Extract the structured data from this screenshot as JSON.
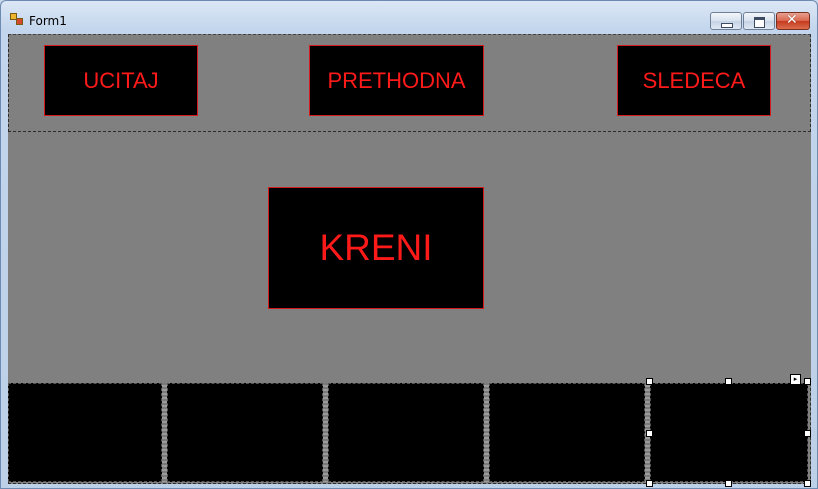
{
  "window": {
    "title": "Form1"
  },
  "caption_buttons": {
    "minimize": "minimize",
    "maximize": "maximize",
    "close": "✕"
  },
  "buttons": {
    "ucitaj": "UCITAJ",
    "prethodna": "PRETHODNA",
    "sledeca": "SLEDECA",
    "kreni": "KRENI"
  },
  "colors": {
    "button_bg": "#000000",
    "button_text": "#ff1a1a",
    "client_bg": "#808080"
  },
  "picture_boxes": [
    {
      "name": "picture-box-1"
    },
    {
      "name": "picture-box-2"
    },
    {
      "name": "picture-box-3"
    },
    {
      "name": "picture-box-4"
    },
    {
      "name": "picture-box-5"
    }
  ]
}
